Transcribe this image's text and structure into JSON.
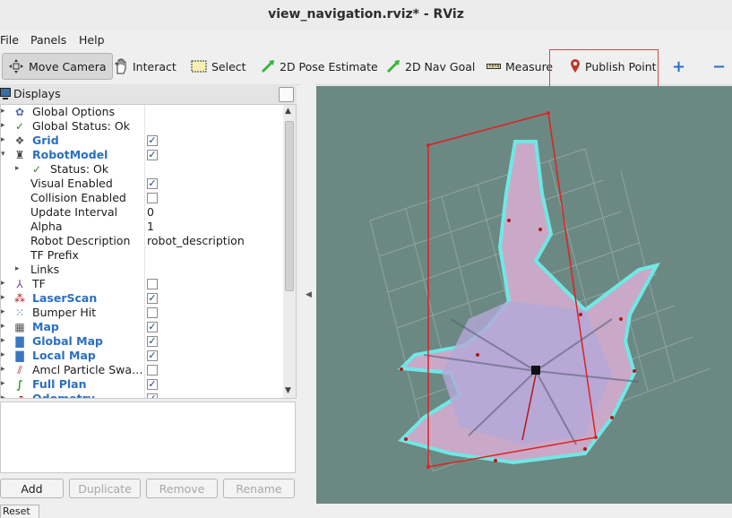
{
  "window": {
    "title": "view_navigation.rviz* - RViz"
  },
  "menu": {
    "items": [
      "File",
      "Panels",
      "Help"
    ]
  },
  "toolbar": {
    "tools": [
      {
        "label": "Move Camera",
        "icon": "move-camera-icon",
        "active": true
      },
      {
        "label": "Interact",
        "icon": "hand-icon"
      },
      {
        "label": "Select",
        "icon": "select-icon"
      },
      {
        "label": "2D Pose Estimate",
        "icon": "green-arrow-icon"
      },
      {
        "label": "2D Nav Goal",
        "icon": "green-arrow-icon"
      },
      {
        "label": "Measure",
        "icon": "ruler-icon"
      },
      {
        "label": "Publish Point",
        "icon": "map-pin-icon"
      }
    ],
    "add_tool": "+",
    "remove_tool": "−",
    "highlight_color": "#e0443b"
  },
  "displays": {
    "header": "Displays",
    "tree": [
      {
        "label": "Global Options",
        "icon": "gear-icon"
      },
      {
        "label": "Global Status: Ok",
        "icon": "check-icon"
      },
      {
        "label": "Grid",
        "icon": "grid-icon",
        "checked": true,
        "bold": true
      },
      {
        "label": "RobotModel",
        "icon": "robot-icon",
        "checked": true,
        "bold": true
      },
      {
        "label": "Status: Ok",
        "icon": "check-icon"
      },
      {
        "label": "Visual Enabled",
        "checked": true
      },
      {
        "label": "Collision Enabled",
        "checked": false
      },
      {
        "label": "Update Interval",
        "value": "0"
      },
      {
        "label": "Alpha",
        "value": "1"
      },
      {
        "label": "Robot Description",
        "value": "robot_description"
      },
      {
        "label": "TF Prefix",
        "value": ""
      },
      {
        "label": "Links"
      },
      {
        "label": "TF",
        "icon": "tf-icon",
        "checked": false
      },
      {
        "label": "LaserScan",
        "icon": "laser-icon",
        "checked": true,
        "bold": true
      },
      {
        "label": "Bumper Hit",
        "icon": "dots-icon",
        "checked": false
      },
      {
        "label": "Map",
        "icon": "map-icon",
        "checked": true,
        "bold": true
      },
      {
        "label": "Global Map",
        "icon": "folder-icon",
        "checked": true,
        "bold": true
      },
      {
        "label": "Local Map",
        "icon": "folder-icon",
        "checked": true,
        "bold": true
      },
      {
        "label": "Amcl Particle Swa…",
        "icon": "arrows-icon",
        "checked": false
      },
      {
        "label": "Full Plan",
        "icon": "path-icon",
        "checked": true,
        "bold": true
      },
      {
        "label": "Odometry",
        "icon": "odom-icon",
        "checked": true,
        "bold": true
      }
    ],
    "buttons": {
      "add": "Add",
      "duplicate": "Duplicate",
      "remove": "Remove",
      "rename": "Rename"
    },
    "bottom_tab": "Reset"
  },
  "colors": {
    "accent_blue": "#2a6fc0",
    "viewport_bg": "#6c8882",
    "free_space": "#c9a9c7",
    "obstacle": "#6ee8e6",
    "boundary": "#e02020"
  }
}
